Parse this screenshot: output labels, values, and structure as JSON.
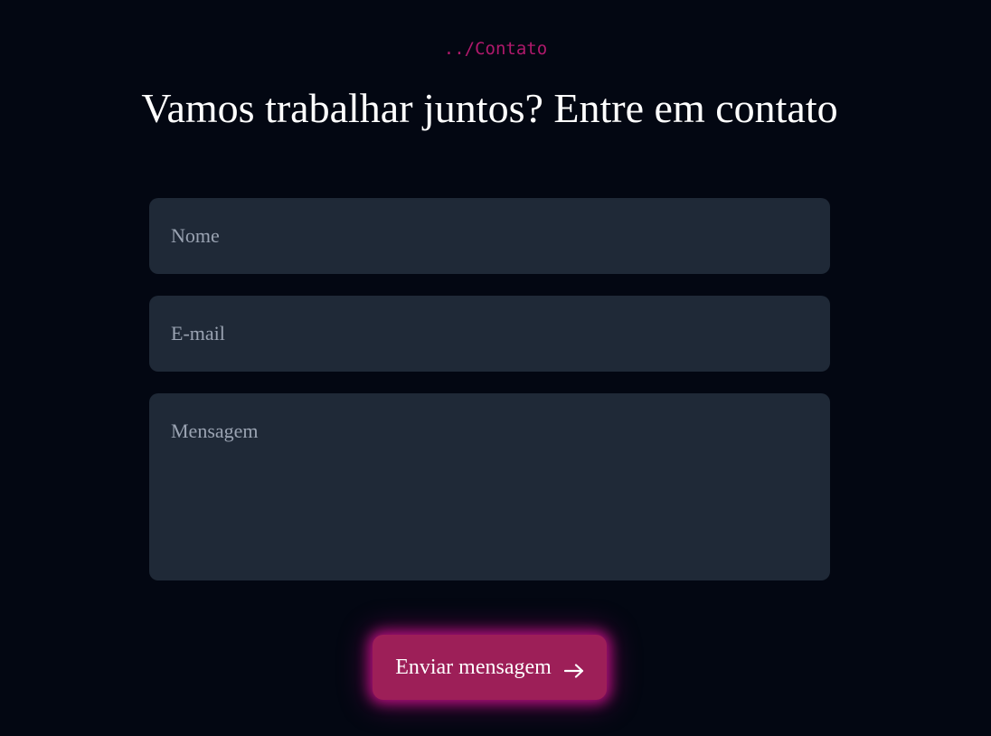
{
  "header": {
    "section_tag": "../Contato",
    "title": "Vamos trabalhar juntos? Entre em contato"
  },
  "form": {
    "name_placeholder": "Nome",
    "email_placeholder": "E-mail",
    "message_placeholder": "Mensagem",
    "submit_label": "Enviar mensagem",
    "submit_icon": "arrow-right-icon"
  },
  "colors": {
    "background": "#030712",
    "accent": "#b0196c",
    "button": "#9d1f58",
    "field": "#1f2937",
    "placeholder": "#9aa3b2"
  }
}
